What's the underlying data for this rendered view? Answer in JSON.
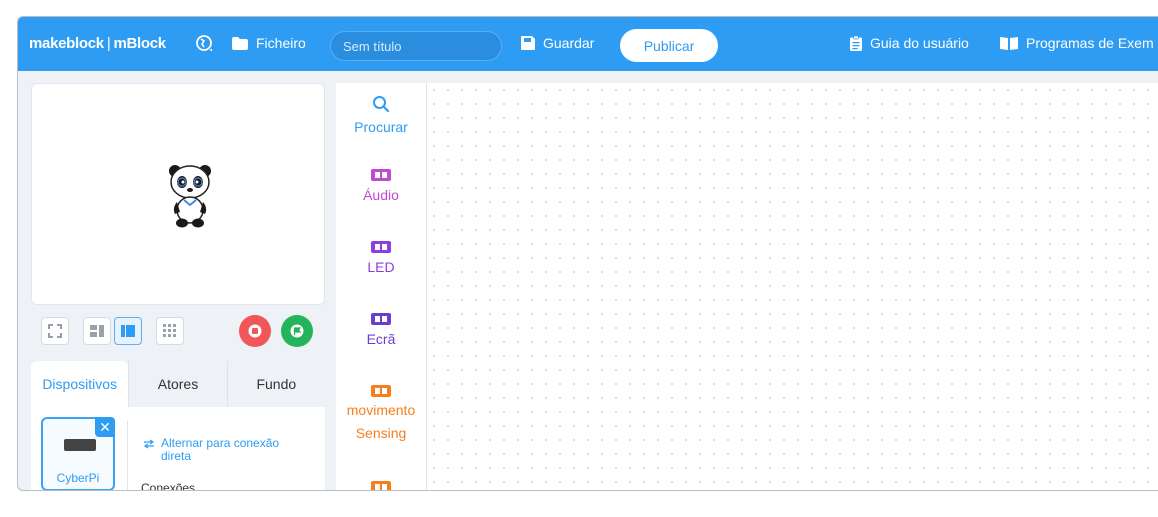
{
  "topbar": {
    "logo_brand": "makeblock",
    "logo_sep": "|",
    "logo_product": "mBlock",
    "file_label": "Ficheiro",
    "title_placeholder": "Sem título",
    "save_label": "Guardar",
    "publish_label": "Publicar",
    "guide_label": "Guia do usuário",
    "examples_label": "Programas de Exem"
  },
  "tabs": [
    {
      "label": "Dispositivos",
      "active": true
    },
    {
      "label": "Atores",
      "active": false
    },
    {
      "label": "Fundo",
      "active": false
    }
  ],
  "devices": {
    "name": "CyberPi",
    "close_glyph": "✕",
    "direct_connection": "Alternar para conexão direta",
    "connections_label": "Conexões"
  },
  "categories": [
    {
      "label": "Procurar",
      "icon": "search-icon",
      "color": "#2e9cf3"
    },
    {
      "label": "Áudio",
      "icon": "audio-block-icon",
      "color": "#c04bd0"
    },
    {
      "label": "LED",
      "icon": "led-block-icon",
      "color": "#8a3fe0"
    },
    {
      "label": "Ecrã",
      "icon": "screen-block-icon",
      "color": "#6a3fd0"
    },
    {
      "label": "movimento",
      "label2": "Sensing",
      "icon": "motion-sensing-block-icon",
      "color": "#f57f1f"
    },
    {
      "label": "",
      "icon": "next-category-block-icon",
      "color": "#f57f1f"
    }
  ],
  "colors": {
    "accent": "#2e9cf3",
    "stop": "#f0565a",
    "go": "#24b45b"
  }
}
